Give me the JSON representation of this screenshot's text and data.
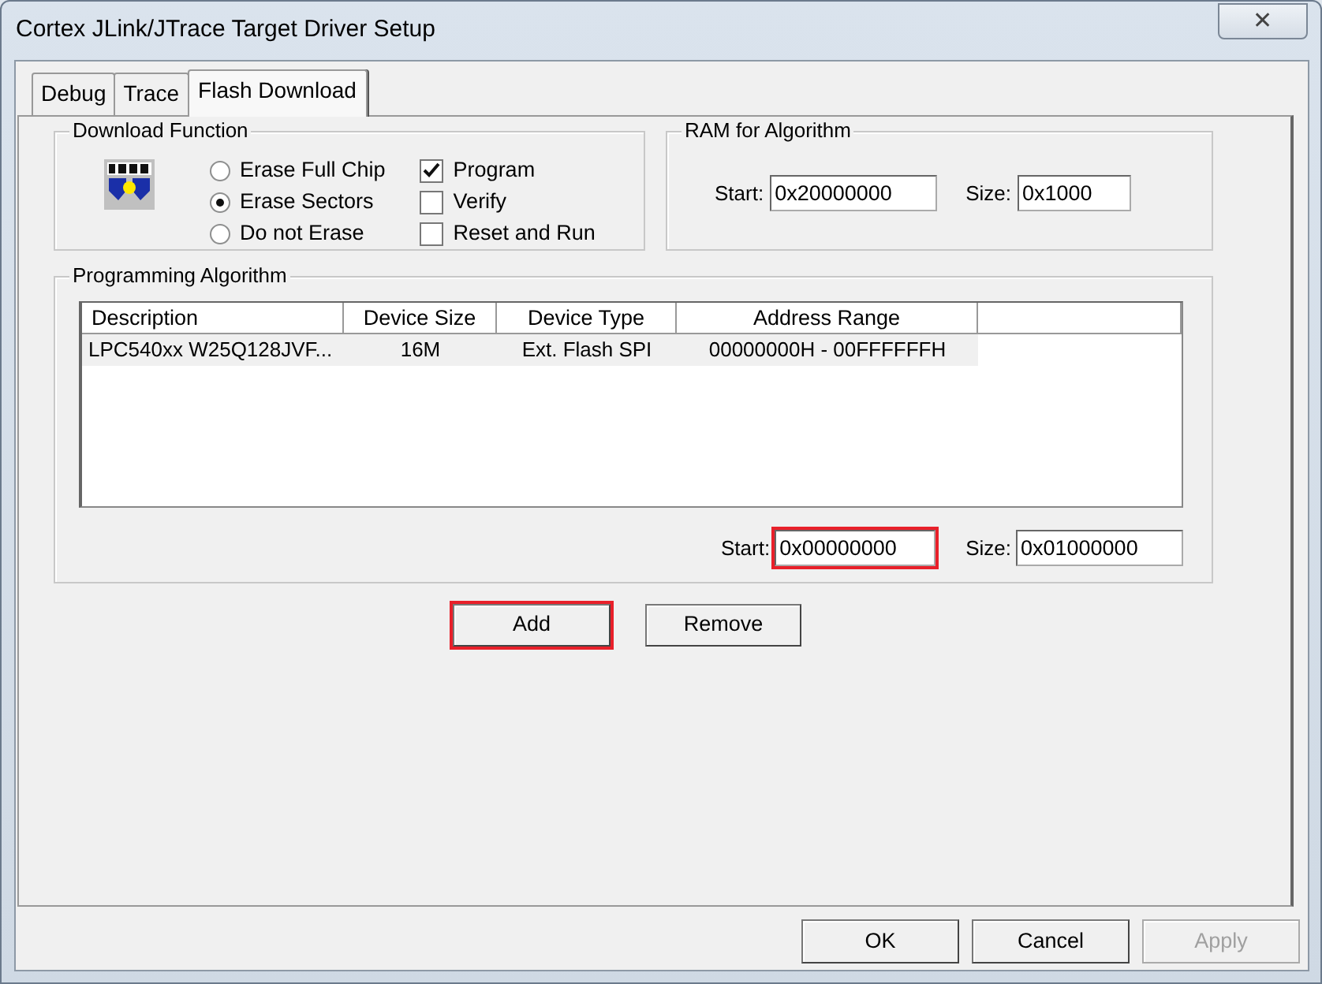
{
  "window": {
    "title": "Cortex JLink/JTrace Target Driver Setup",
    "close": "✕"
  },
  "tabs": [
    {
      "label": "Debug",
      "selected": false
    },
    {
      "label": "Trace",
      "selected": false
    },
    {
      "label": "Flash Download",
      "selected": true
    }
  ],
  "download_function": {
    "title": "Download Function",
    "options": [
      {
        "label": "Erase Full Chip",
        "selected": false
      },
      {
        "label": "Erase Sectors",
        "selected": true
      },
      {
        "label": "Do not Erase",
        "selected": false
      }
    ],
    "checks": [
      {
        "label": "Program",
        "checked": true
      },
      {
        "label": "Verify",
        "checked": false
      },
      {
        "label": "Reset and Run",
        "checked": false
      }
    ]
  },
  "ram_for_algorithm": {
    "title": "RAM for Algorithm",
    "start_label": "Start:",
    "start": "0x20000000",
    "size_label": "Size:",
    "size": "0x1000"
  },
  "programming_algorithm": {
    "title": "Programming Algorithm",
    "columns": [
      "Description",
      "Device Size",
      "Device Type",
      "Address Range"
    ],
    "rows": [
      {
        "cells": [
          "LPC540xx W25Q128JVF...",
          "16M",
          "Ext. Flash SPI",
          "00000000H - 00FFFFFFH"
        ],
        "selected": false
      }
    ],
    "start_label": "Start:",
    "start": "0x00000000",
    "start_highlighted": true,
    "size_label": "Size:",
    "size": "0x01000000"
  },
  "actions": [
    {
      "label": "Add",
      "highlighted": true
    },
    {
      "label": "Remove",
      "highlighted": false
    }
  ],
  "buttons": [
    {
      "label": "OK",
      "disabled": false
    },
    {
      "label": "Cancel",
      "disabled": false
    },
    {
      "label": "Apply",
      "disabled": true
    }
  ]
}
